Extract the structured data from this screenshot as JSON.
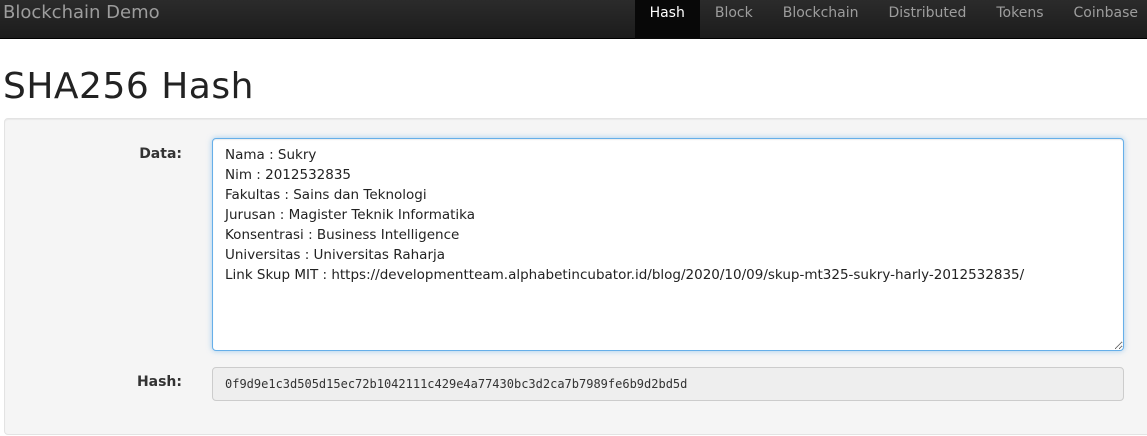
{
  "navbar": {
    "brand": "Blockchain Demo",
    "items": [
      {
        "label": "Hash",
        "active": true
      },
      {
        "label": "Block",
        "active": false
      },
      {
        "label": "Blockchain",
        "active": false
      },
      {
        "label": "Distributed",
        "active": false
      },
      {
        "label": "Tokens",
        "active": false
      },
      {
        "label": "Coinbase",
        "active": false
      }
    ]
  },
  "page": {
    "title": "SHA256 Hash"
  },
  "form": {
    "data_label": "Data:",
    "data_value": "Nama : Sukry\nNim : 2012532835\nFakultas : Sains dan Teknologi\nJurusan : Magister Teknik Informatika\nKonsentrasi : Business Intelligence\nUniversitas : Universitas Raharja\nLink Skup MIT : https://developmentteam.alphabetincubator.id/blog/2020/10/09/skup-mt325-sukry-harly-2012532835/",
    "hash_label": "Hash:",
    "hash_value": "0f9d9e1c3d505d15ec72b1042111c429e4a77430bc3d2ca7b7989fe6b9d2bd5d"
  },
  "colors": {
    "navbar_bg": "#222222",
    "active_tab_bg": "#080808",
    "focus_border": "#66afe9"
  }
}
